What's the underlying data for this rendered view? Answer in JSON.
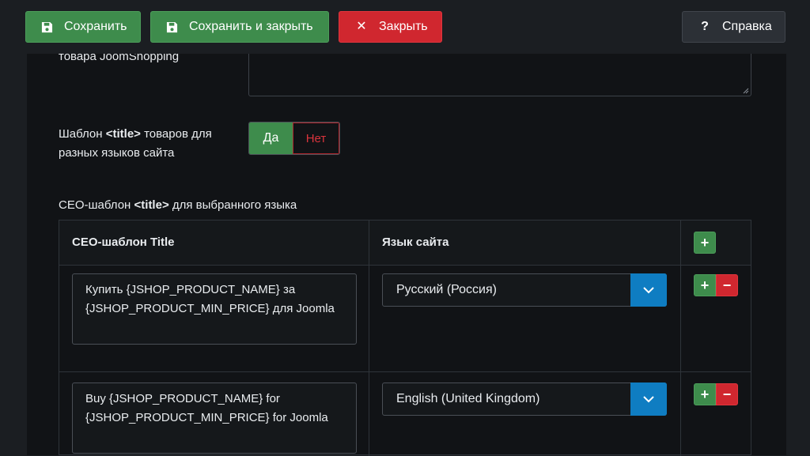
{
  "toolbar": {
    "save_label": "Сохранить",
    "save_close_label": "Сохранить и закрыть",
    "close_label": "Закрыть",
    "help_label": "Справка",
    "help_icon_glyph": "?",
    "close_icon_glyph": "✕"
  },
  "form": {
    "top_label": "товара JoomShopping",
    "top_textarea_value": "",
    "title_template_label_pre": "Шаблон ",
    "title_template_label_bold": "<title>",
    "title_template_label_post": " товаров для разных языков сайта",
    "switch_yes": "Да",
    "switch_no": "Нет",
    "switch_selected": "Да",
    "seo_section_label_pre": "СЕО-шаблон ",
    "seo_section_label_bold": "<title>",
    "seo_section_label_post": " для выбранного языка"
  },
  "table": {
    "col_template": "СЕО-шаблон Title",
    "col_language": "Язык сайта",
    "add_glyph": "+",
    "remove_glyph": "−",
    "rows": [
      {
        "template": "Купить {JSHOP_PRODUCT_NAME} за {JSHOP_PRODUCT_MIN_PRICE} для Joomla",
        "language": "Русский (Россия)"
      },
      {
        "template": "Buy {JSHOP_PRODUCT_NAME} for {JSHOP_PRODUCT_MIN_PRICE} for Joomla",
        "language": "English (United Kingdom)"
      }
    ]
  },
  "colors": {
    "success": "#3e8c4c",
    "danger": "#d0272f",
    "primary": "#0f7dc2",
    "background": "#111316"
  }
}
